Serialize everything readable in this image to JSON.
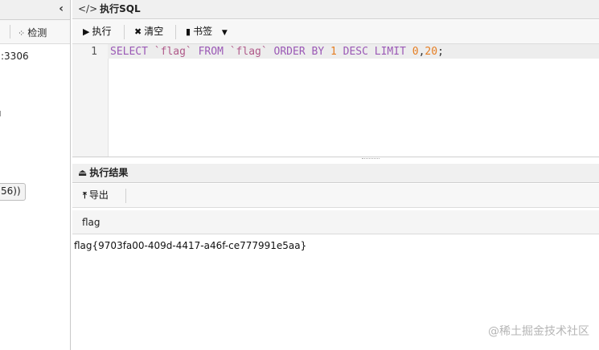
{
  "sidebar": {
    "collapse_icon": "‹",
    "check_label": "检测",
    "connection_port": ":3306",
    "connection_entry": "56))"
  },
  "sql_panel": {
    "title": "执行SQL",
    "run_label": "执行",
    "clear_label": "清空",
    "bookmark_label": "书签",
    "line_number": "1",
    "query_tokens": {
      "select": "SELECT",
      "col": "`flag`",
      "from": "FROM",
      "table": "`flag`",
      "orderby": "ORDER BY",
      "one": "1",
      "desc": "DESC",
      "limit": "LIMIT",
      "zero": "0",
      "comma": ",",
      "twenty": "20",
      "semicolon": ";"
    }
  },
  "results_panel": {
    "title": "执行结果",
    "export_label": "导出",
    "columns": [
      "flag"
    ],
    "rows": [
      [
        "flag{9703fa00-409d-4417-a46f-ce777991e5aa}"
      ]
    ]
  },
  "watermark": "@稀土掘金技术社区"
}
